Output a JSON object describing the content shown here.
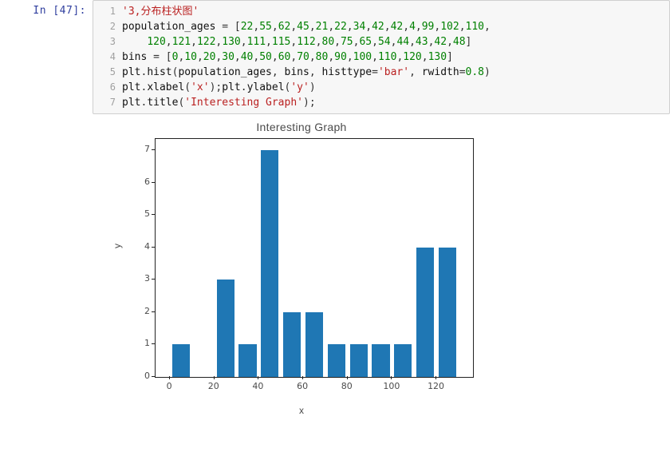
{
  "cell": {
    "prompt_prefix": "In ",
    "prompt_num": "[47]:",
    "lines": [
      {
        "n": "1",
        "html": "<span class='s-str'>'3,分布柱状图'</span>"
      },
      {
        "n": "2",
        "html": "<span class='s-name'>population_ages</span> <span class='s-punc'>=</span> <span class='s-punc'>[</span><span class='s-num'>22</span><span class='s-punc'>,</span><span class='s-num'>55</span><span class='s-punc'>,</span><span class='s-num'>62</span><span class='s-punc'>,</span><span class='s-num'>45</span><span class='s-punc'>,</span><span class='s-num'>21</span><span class='s-punc'>,</span><span class='s-num'>22</span><span class='s-punc'>,</span><span class='s-num'>34</span><span class='s-punc'>,</span><span class='s-num'>42</span><span class='s-punc'>,</span><span class='s-num'>42</span><span class='s-punc'>,</span><span class='s-num'>4</span><span class='s-punc'>,</span><span class='s-num'>99</span><span class='s-punc'>,</span><span class='s-num'>102</span><span class='s-punc'>,</span><span class='s-num'>110</span><span class='s-punc'>,</span>"
      },
      {
        "n": "3",
        "html": "    <span class='s-num'>120</span><span class='s-punc'>,</span><span class='s-num'>121</span><span class='s-punc'>,</span><span class='s-num'>122</span><span class='s-punc'>,</span><span class='s-num'>130</span><span class='s-punc'>,</span><span class='s-num'>111</span><span class='s-punc'>,</span><span class='s-num'>115</span><span class='s-punc'>,</span><span class='s-num'>112</span><span class='s-punc'>,</span><span class='s-num'>80</span><span class='s-punc'>,</span><span class='s-num'>75</span><span class='s-punc'>,</span><span class='s-num'>65</span><span class='s-punc'>,</span><span class='s-num'>54</span><span class='s-punc'>,</span><span class='s-num'>44</span><span class='s-punc'>,</span><span class='s-num'>43</span><span class='s-punc'>,</span><span class='s-num'>42</span><span class='s-punc'>,</span><span class='s-num'>48</span><span class='s-punc'>]</span>"
      },
      {
        "n": "4",
        "html": "<span class='s-name'>bins</span> <span class='s-punc'>=</span> <span class='s-punc'>[</span><span class='s-num'>0</span><span class='s-punc'>,</span><span class='s-num'>10</span><span class='s-punc'>,</span><span class='s-num'>20</span><span class='s-punc'>,</span><span class='s-num'>30</span><span class='s-punc'>,</span><span class='s-num'>40</span><span class='s-punc'>,</span><span class='s-num'>50</span><span class='s-punc'>,</span><span class='s-num'>60</span><span class='s-punc'>,</span><span class='s-num'>70</span><span class='s-punc'>,</span><span class='s-num'>80</span><span class='s-punc'>,</span><span class='s-num'>90</span><span class='s-punc'>,</span><span class='s-num'>100</span><span class='s-punc'>,</span><span class='s-num'>110</span><span class='s-punc'>,</span><span class='s-num'>120</span><span class='s-punc'>,</span><span class='s-num'>130</span><span class='s-punc'>]</span>"
      },
      {
        "n": "5",
        "html": "<span class='s-name'>plt</span><span class='s-punc'>.</span><span class='s-name'>hist</span><span class='s-punc'>(</span><span class='s-name'>population_ages</span><span class='s-punc'>,</span> <span class='s-name'>bins</span><span class='s-punc'>,</span> <span class='s-name'>histtype</span><span class='s-punc'>=</span><span class='s-str'>'bar'</span><span class='s-punc'>,</span> <span class='s-name'>rwidth</span><span class='s-punc'>=</span><span class='s-num'>0.8</span><span class='s-punc'>)</span>"
      },
      {
        "n": "6",
        "html": "<span class='s-name'>plt</span><span class='s-punc'>.</span><span class='s-name'>xlabel</span><span class='s-punc'>(</span><span class='s-str'>'x'</span><span class='s-punc'>);</span><span class='s-name'>plt</span><span class='s-punc'>.</span><span class='s-name'>ylabel</span><span class='s-punc'>(</span><span class='s-str'>'y'</span><span class='s-punc'>)</span>"
      },
      {
        "n": "7",
        "html": "<span class='s-name'>plt</span><span class='s-punc'>.</span><span class='s-name'>title</span><span class='s-punc'>(</span><span class='s-str'>'Interesting Graph'</span><span class='s-punc'>);</span>"
      }
    ]
  },
  "chart_data": {
    "type": "bar",
    "title": "Interesting Graph",
    "xlabel": "x",
    "ylabel": "y",
    "xlim": [
      -6.5,
      136.5
    ],
    "ylim": [
      0,
      7.35
    ],
    "xticks": [
      0,
      20,
      40,
      60,
      80,
      100,
      120
    ],
    "yticks": [
      0,
      1,
      2,
      3,
      4,
      5,
      6,
      7
    ],
    "rwidth": 0.8,
    "bins": [
      0,
      10,
      20,
      30,
      40,
      50,
      60,
      70,
      80,
      90,
      100,
      110,
      120,
      130
    ],
    "values": [
      1,
      0,
      3,
      1,
      7,
      2,
      2,
      1,
      1,
      1,
      1,
      4,
      4
    ],
    "bar_color": "#1f77b4"
  }
}
